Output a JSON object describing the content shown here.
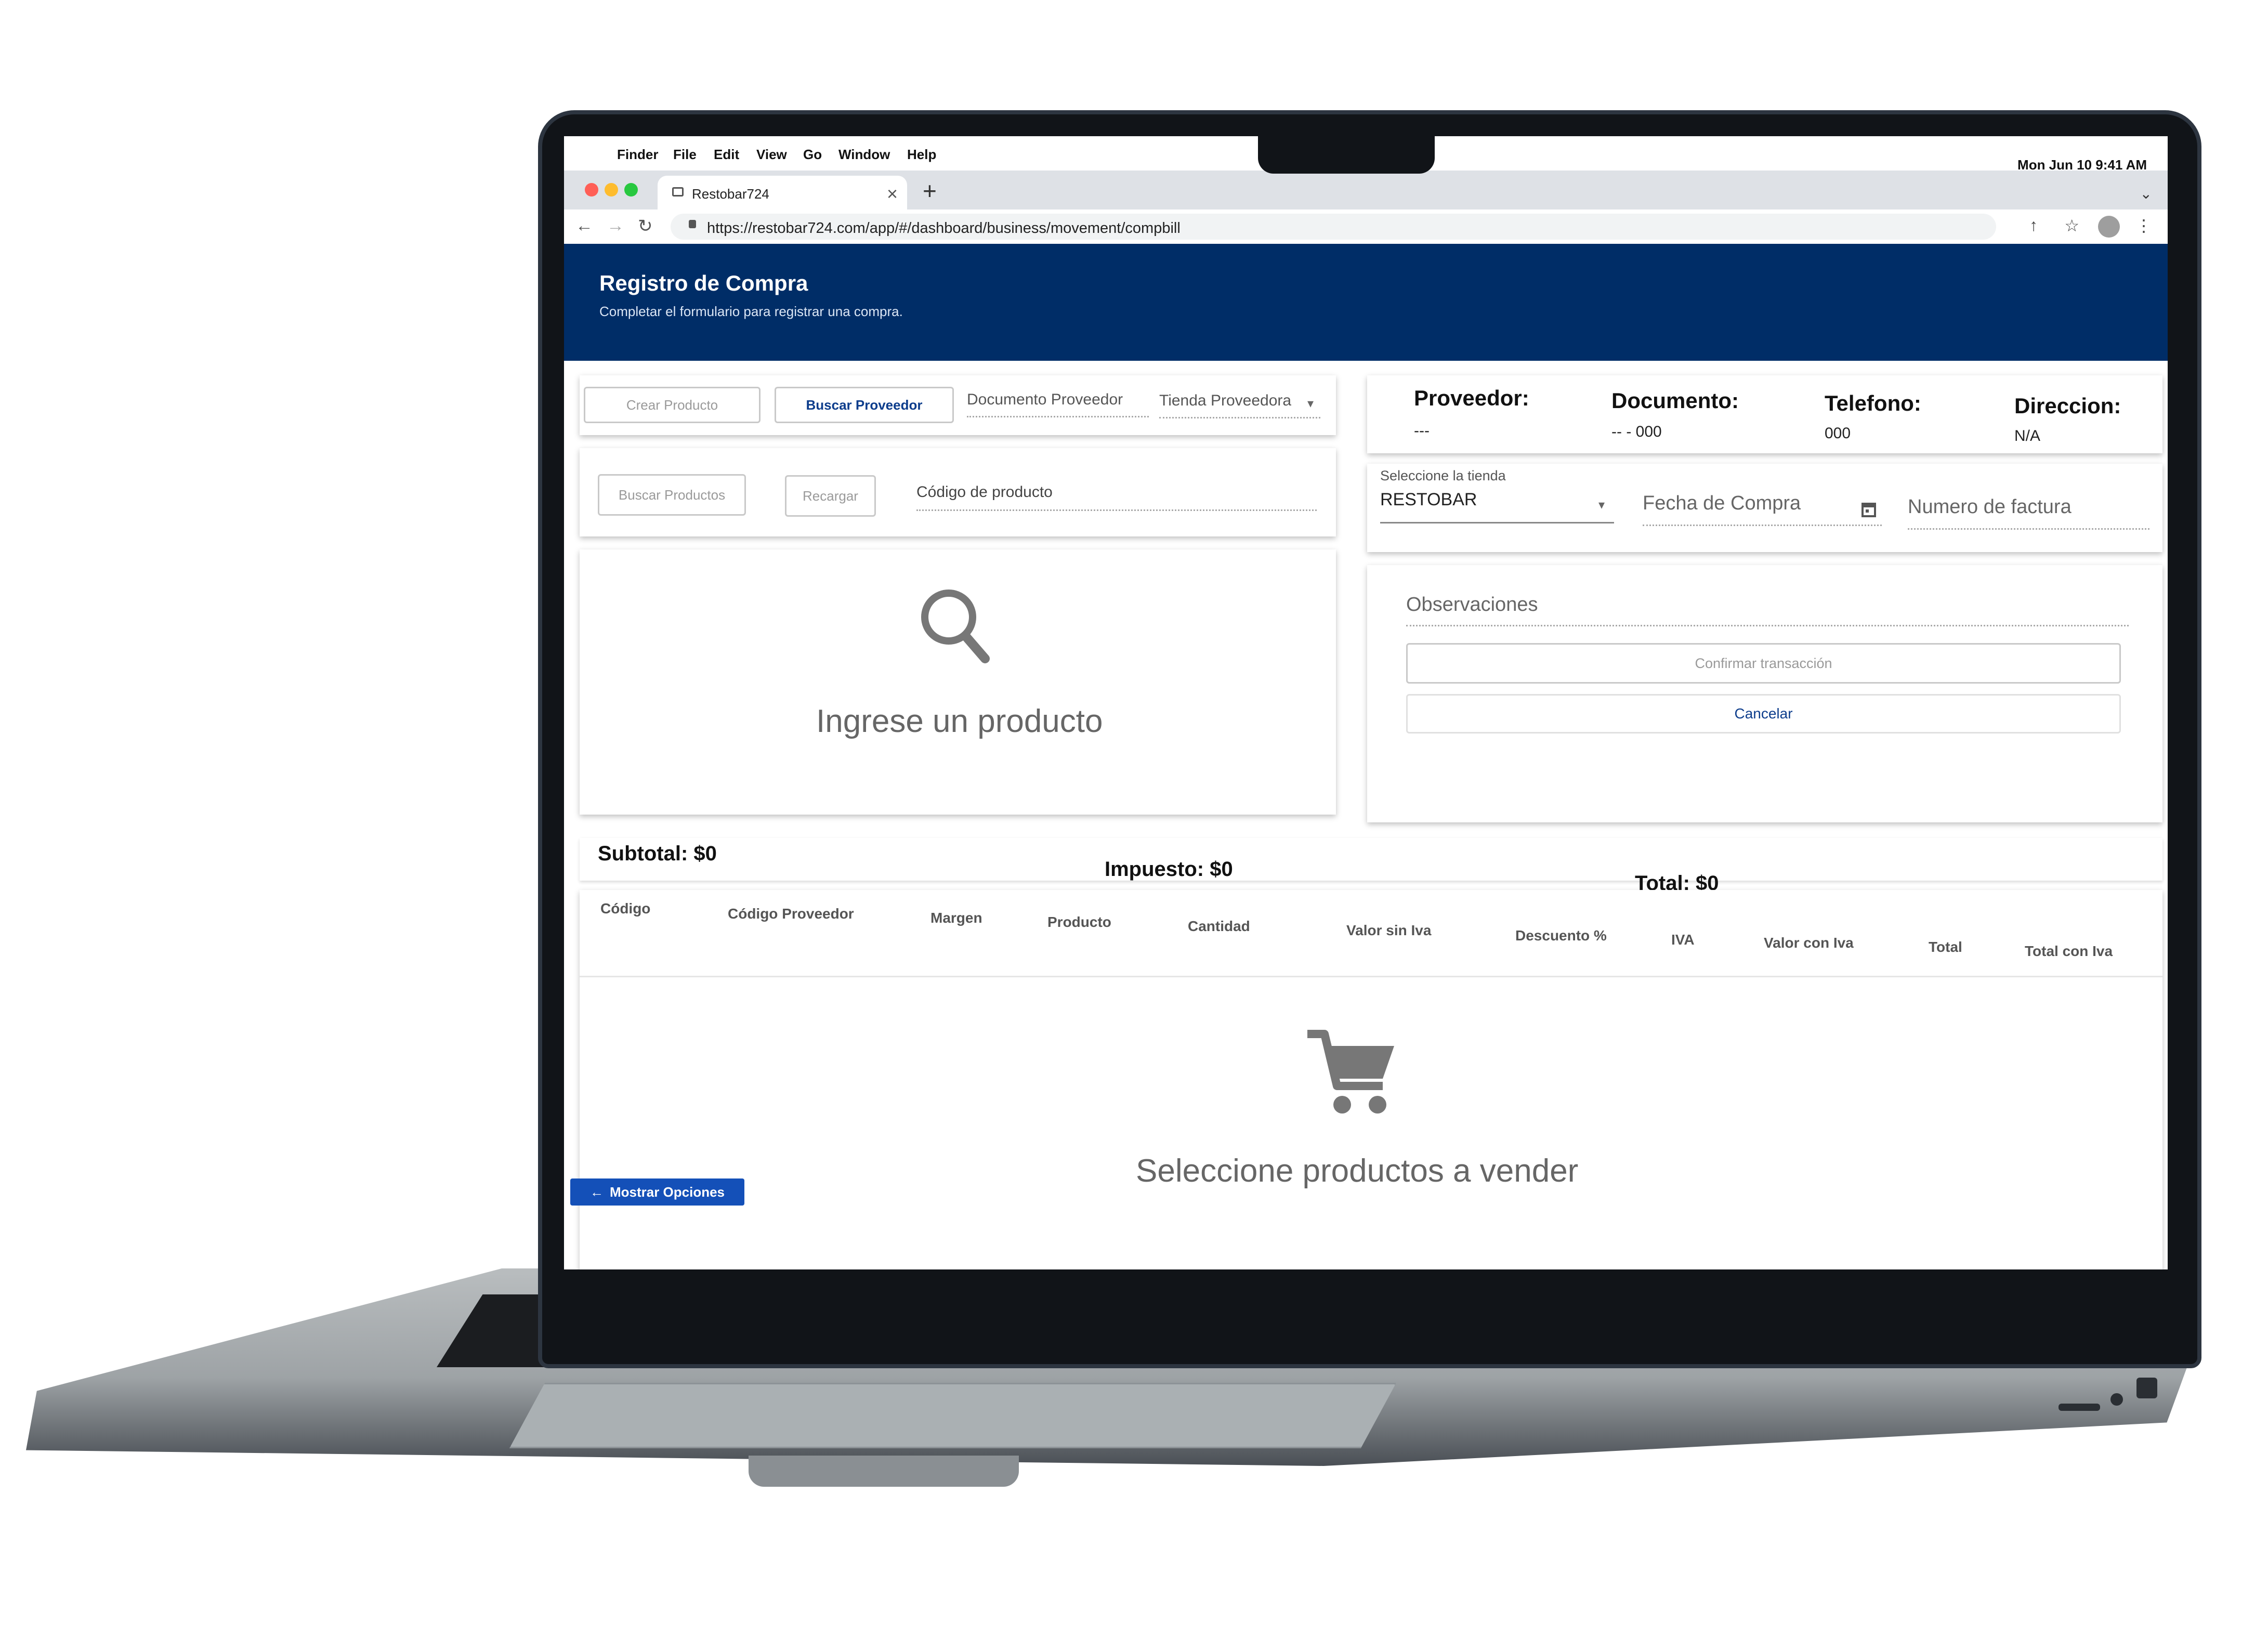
{
  "menubar": {
    "items": [
      "Finder",
      "File",
      "Edit",
      "View",
      "Go",
      "Window",
      "Help"
    ],
    "clock": "Mon Jun 10  9:41 AM"
  },
  "browser": {
    "tab_title": "Restobar724",
    "tab_close": "×",
    "new_tab": "+",
    "url": "https://restobar724.com/app/#/dashboard/business/movement/compbill"
  },
  "header": {
    "title": "Registro de Compra",
    "subtitle": "Completar el formulario para registrar una compra."
  },
  "toolbar": {
    "crear_producto": "Crear Producto",
    "buscar_proveedor": "Buscar Proveedor",
    "documento_proveedor": "Documento Proveedor",
    "tienda_proveedora": "Tienda Proveedora"
  },
  "product_search": {
    "buscar_productos": "Buscar Productos",
    "recargar": "Recargar",
    "codigo_producto": "Código de producto"
  },
  "product_empty": {
    "message": "Ingrese un producto"
  },
  "supplier_info": {
    "proveedor_label": "Proveedor:",
    "proveedor_value": "---",
    "documento_label": "Documento:",
    "documento_value": "-- - 000",
    "telefono_label": "Telefono:",
    "telefono_value": "000",
    "direccion_label": "Direccion:",
    "direccion_value": "N/A"
  },
  "store_form": {
    "tienda_label": "Seleccione la tienda",
    "tienda_value": "RESTOBAR",
    "fecha_compra": "Fecha de Compra",
    "numero_factura": "Numero de factura"
  },
  "actions": {
    "observaciones": "Observaciones",
    "confirmar": "Confirmar transacción",
    "cancelar": "Cancelar"
  },
  "totals": {
    "subtotal": "Subtotal: $0",
    "impuesto": "Impuesto: $0",
    "total": "Total: $0"
  },
  "table": {
    "headers": [
      "Código",
      "Código Proveedor",
      "Margen",
      "Producto",
      "Cantidad",
      "Valor sin Iva",
      "Descuento %",
      "IVA",
      "Valor con Iva",
      "Total",
      "Total con Iva"
    ],
    "empty_message": "Seleccione productos a vender"
  },
  "mostrar_opciones": "Mostrar Opciones",
  "colors": {
    "header_bg": "#002d67",
    "primary_button": "#1450b8",
    "traffic_red": "#ff5f57",
    "traffic_yellow": "#febc2e",
    "traffic_green": "#28c840"
  },
  "icons": [
    "search-icon",
    "cart-icon",
    "calendar-icon",
    "arrow-left-icon",
    "back-icon",
    "forward-icon",
    "reload-icon",
    "lock-icon",
    "share-icon",
    "star-icon",
    "more-icon"
  ]
}
